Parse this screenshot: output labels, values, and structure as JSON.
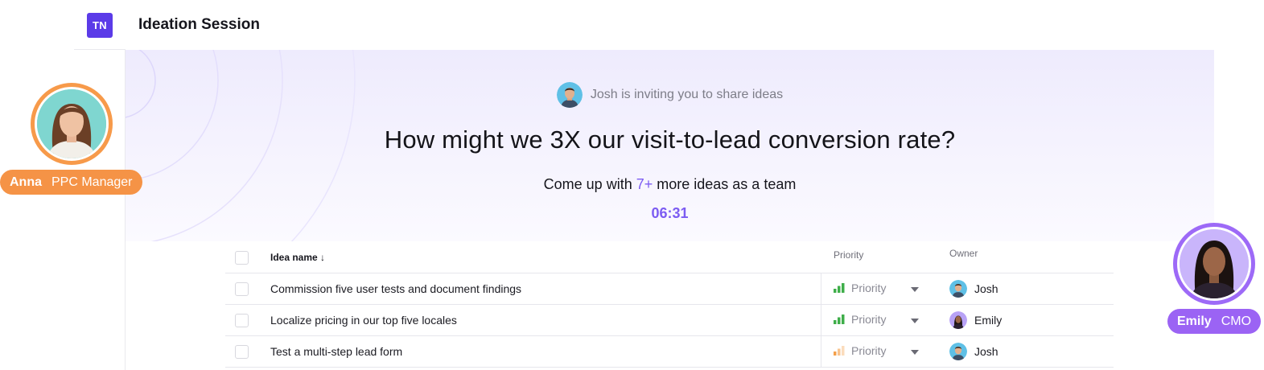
{
  "workspace": {
    "badge": "TN"
  },
  "app": {
    "title": "Ideation Session"
  },
  "hero": {
    "invite_text": "Josh is inviting you to share ideas",
    "question": "How might we 3X our visit-to-lead conversion rate?",
    "goal_prefix": "Come up with ",
    "goal_count": "7+",
    "goal_suffix": " more ideas as a team",
    "timer": "06:31"
  },
  "table": {
    "columns": {
      "name": "Idea name ↓",
      "priority": "Priority",
      "owner": "Owner"
    },
    "rows": [
      {
        "name": "Commission five user tests and document findings",
        "priority": "Priority",
        "priority_level": "high",
        "owner": "Josh"
      },
      {
        "name": "Localize pricing in our top five locales",
        "priority": "Priority",
        "priority_level": "high",
        "owner": "Emily"
      },
      {
        "name": "Test a multi-step lead form",
        "priority": "Priority",
        "priority_level": "low",
        "owner": "Josh"
      }
    ]
  },
  "personas": {
    "anna": {
      "name": "Anna",
      "role": "PPC Manager",
      "color": "#f59346"
    },
    "emily": {
      "name": "Emily",
      "role": "CMO",
      "color": "#9b63f4"
    }
  },
  "colors": {
    "accent": "#7c5cf2",
    "brand": "#5b3be8",
    "priority_high": "#3fae4a",
    "priority_low": "#f5a04a"
  }
}
